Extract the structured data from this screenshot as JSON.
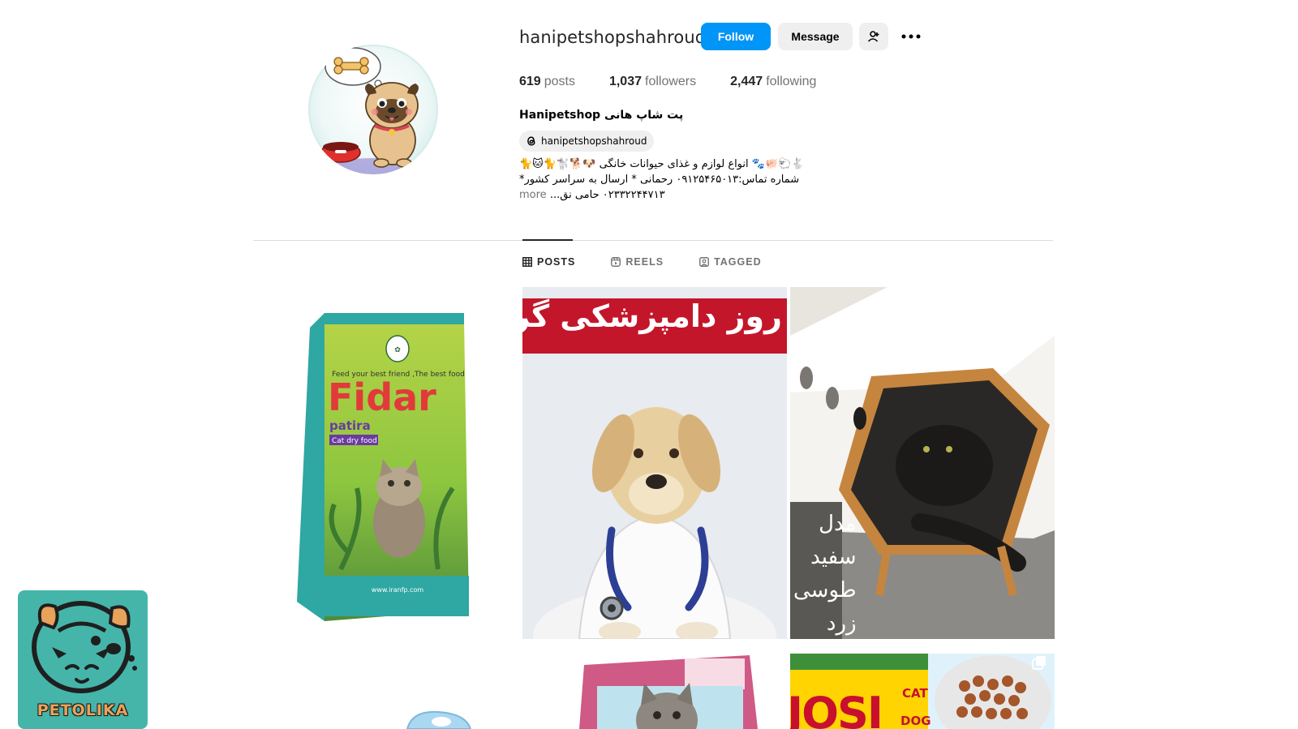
{
  "profile": {
    "username": "hanipetshopshahroud",
    "follow_label": "Follow",
    "message_label": "Message",
    "posts_count": "619",
    "posts_label": "posts",
    "followers_count": "1,037",
    "followers_label": "followers",
    "following_count": "2,447",
    "following_label": "following",
    "full_name": "Hanipetshop پت شاپ هانی",
    "threads_handle": "hanipetshopshahroud",
    "bio_line1": "🐇🐑🐖🐾 انواع لوازم و غذای حیوانات خانگی 🐶🐕🐩🐈🐱🐈",
    "bio_line2": "شماره تماس:۰۹۱۲۵۴۶۵۰۱۳ رحمانی * ارسال به سراسر کشور*",
    "bio_line3": "۰۲۳۳۲۲۴۴۷۱۳ حامی نق...",
    "bio_more": "more"
  },
  "tabs": [
    {
      "label": "POSTS",
      "active": true,
      "icon": "grid-icon"
    },
    {
      "label": "REELS",
      "active": false,
      "icon": "reels-icon"
    },
    {
      "label": "TAGGED",
      "active": false,
      "icon": "tagged-icon"
    }
  ],
  "posts": {
    "fidar_brand": "Fidar",
    "fidar_sub": "patira",
    "fidar_type": "Cat dry food",
    "fidar_tagline": "Feed your best friend ,The best food",
    "fidar_site": "www.iranfp.com",
    "vet_banner": "روز دامپزشکی گرامی باد",
    "cat_house_text": "مدل\nسفید\nطوسی\nزرد",
    "josi_text": "JOSI",
    "josi_cat": "CAT",
    "josi_dog": "DOG",
    "petolika_label": "PETOLIKA"
  },
  "colors": {
    "follow_blue": "#0095f6",
    "button_gray": "#efefef",
    "text_muted": "#737373",
    "divider": "#dbdbdb",
    "petolika_teal": "#45b5aa"
  }
}
